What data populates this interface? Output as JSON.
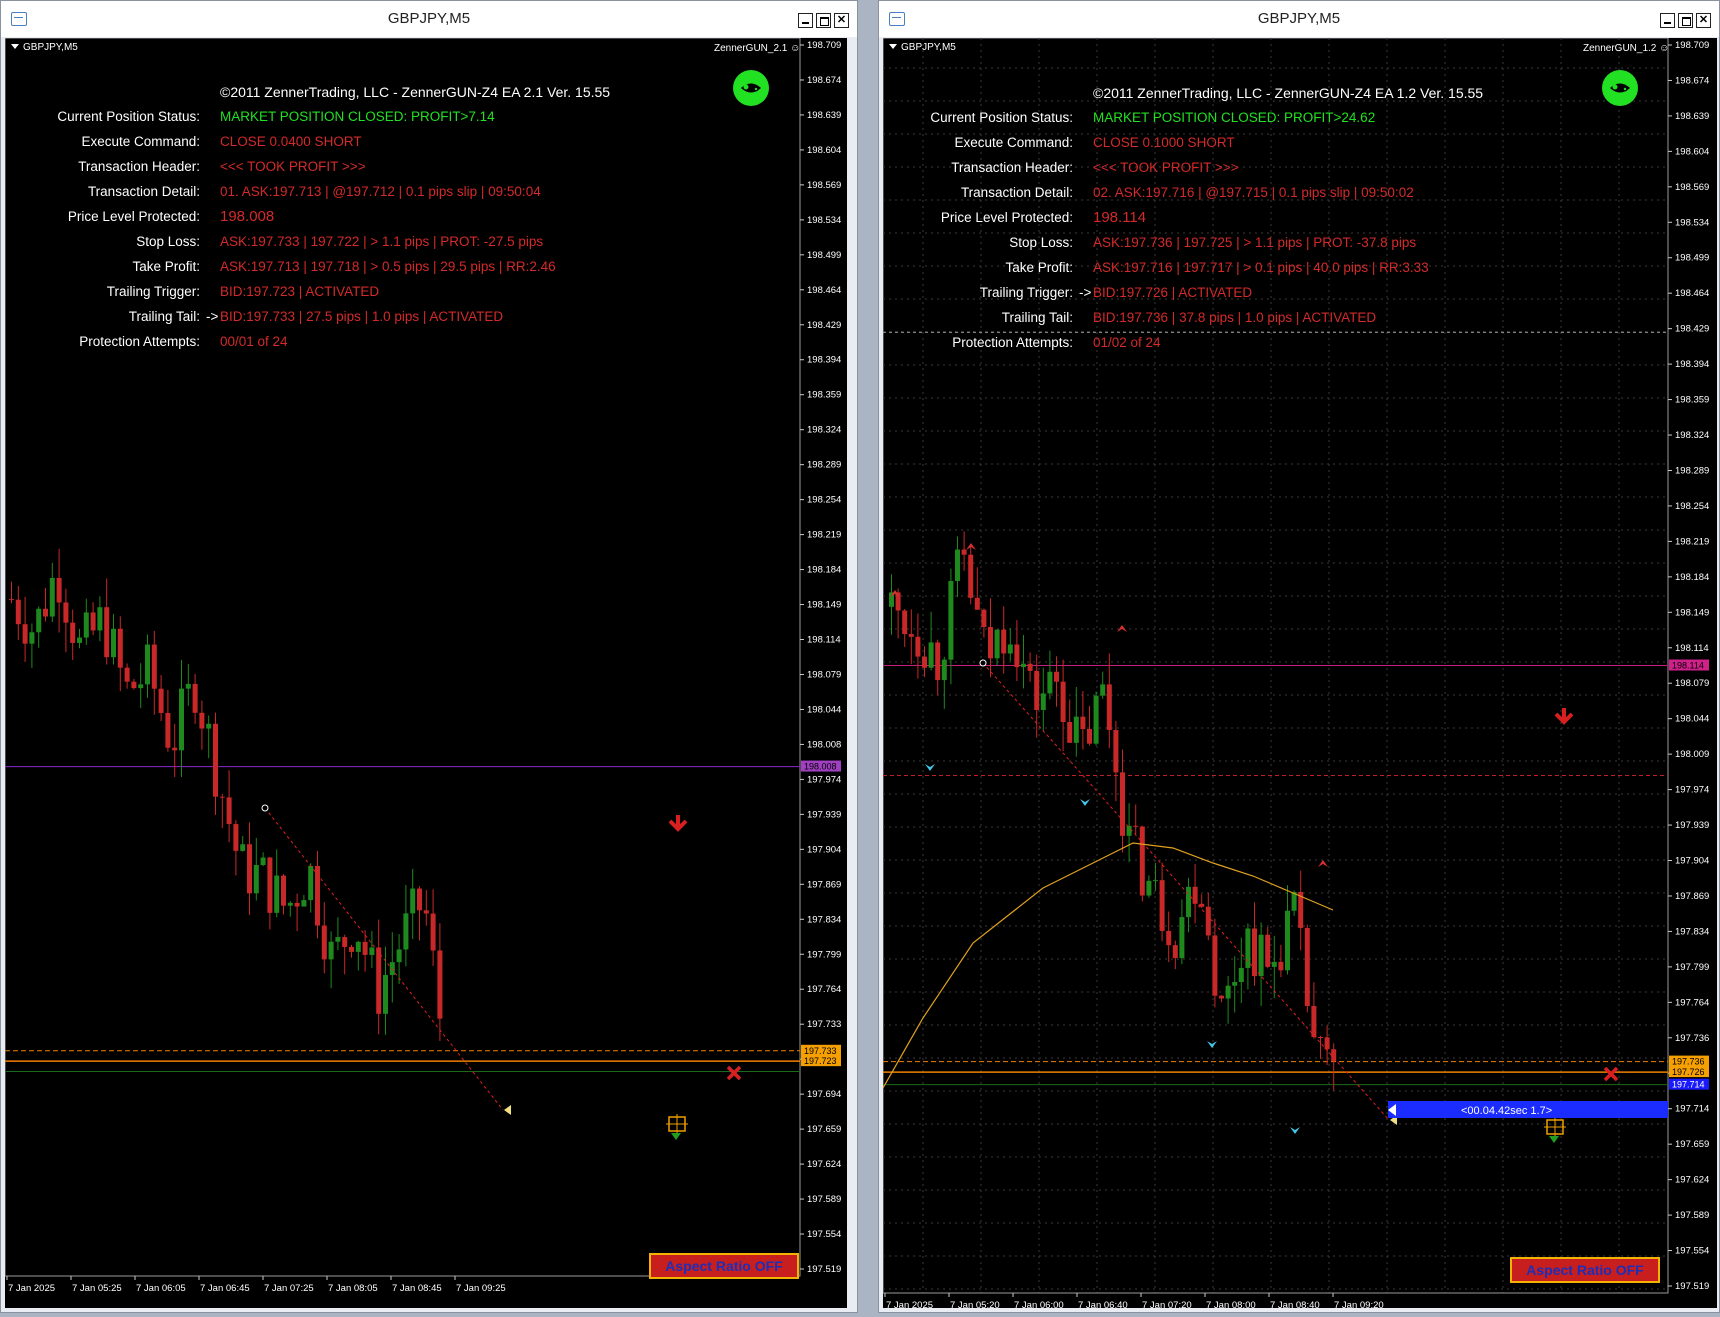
{
  "windows": [
    {
      "id": "left",
      "title": "GBPJPY,M5",
      "symbol_label": "GBPJPY,M5",
      "ea_label": "ZennerGUN_2.1",
      "hud": {
        "copyright": "©2011 ZennerTrading, LLC - ZennerGUN-Z4 EA 2.1 Ver. 15.55",
        "rows": [
          {
            "label": "Current Position Status:",
            "value": "MARKET POSITION CLOSED: PROFIT>7.14",
            "style": "green"
          },
          {
            "label": "Execute Command:",
            "value": "CLOSE 0.0400 SHORT",
            "style": "red"
          },
          {
            "label": "Transaction Header:",
            "value": "<<< TOOK PROFIT >>>",
            "style": "red"
          },
          {
            "label": "Transaction Detail:",
            "value": "01. ASK:197.713 |  @197.712 | 0.1 pips slip | 09:50:04",
            "style": "red"
          },
          {
            "label": "Price Level Protected:",
            "value": "198.008",
            "style": "big"
          },
          {
            "label": "Stop Loss:",
            "value": "ASK:197.733 | 197.722 | > 1.1 pips |  PROT: -27.5 pips",
            "style": "red"
          },
          {
            "label": "Take Profit:",
            "value": "ASK:197.713 | 197.718 | > 0.5 pips | 29.5 pips | RR:2.46",
            "style": "red"
          },
          {
            "label": "Trailing Trigger:",
            "value": "BID:197.723 | ACTIVATED",
            "style": "red"
          },
          {
            "label": "Trailing Tail:",
            "value": "BID:197.733 | 27.5 pips | 1.0 pips | ACTIVATED",
            "style": "red",
            "arrow": "->"
          },
          {
            "label": "Protection Attempts:",
            "value": "00/01 of 24",
            "style": "red"
          }
        ]
      },
      "price_axis": [
        "198.709",
        "198.674",
        "198.639",
        "198.604",
        "198.569",
        "198.534",
        "198.499",
        "198.464",
        "198.429",
        "198.394",
        "198.359",
        "198.324",
        "198.289",
        "198.254",
        "198.219",
        "198.184",
        "198.149",
        "198.114",
        "198.079",
        "198.044",
        "198.008",
        "197.974",
        "197.939",
        "197.904",
        "197.869",
        "197.834",
        "197.799",
        "197.764",
        "197.733",
        "197.723",
        "197.694",
        "197.659",
        "197.624",
        "197.589",
        "197.554",
        "197.519"
      ],
      "price_tags": [
        {
          "text": "198.008",
          "color": "#a040c0",
          "price": 198.008
        },
        {
          "text": "197.733",
          "color": "#f5a000",
          "price": 197.733
        },
        {
          "text": "197.723",
          "color": "#f5a000",
          "price": 197.723
        }
      ],
      "time_axis": [
        "7 Jan 2025",
        "7 Jan 05:25",
        "7 Jan 06:05",
        "7 Jan 06:45",
        "7 Jan 07:25",
        "7 Jan 08:05",
        "7 Jan 08:45",
        "7 Jan 09:25"
      ],
      "aspect_button": "Aspect Ratio OFF"
    },
    {
      "id": "right",
      "title": "GBPJPY,M5",
      "symbol_label": "GBPJPY,M5",
      "ea_label": "ZennerGUN_1.2",
      "hud": {
        "copyright": "©2011 ZennerTrading, LLC - ZennerGUN-Z4 EA 1.2 Ver. 15.55",
        "rows": [
          {
            "label": "Current Position Status:",
            "value": "MARKET POSITION CLOSED: PROFIT>24.62",
            "style": "green"
          },
          {
            "label": "Execute Command:",
            "value": "CLOSE 0.1000 SHORT",
            "style": "red"
          },
          {
            "label": "Transaction Header:",
            "value": "<<< TOOK PROFIT >>>",
            "style": "red"
          },
          {
            "label": "Transaction Detail:",
            "value": "02. ASK:197.716 |  @197.715 | 0.1 pips slip | 09:50:02",
            "style": "red"
          },
          {
            "label": "Price Level Protected:",
            "value": "198.114",
            "style": "big"
          },
          {
            "label": "Stop Loss:",
            "value": "ASK:197.736 | 197.725 | > 1.1 pips |  PROT: -37.8 pips",
            "style": "red"
          },
          {
            "label": "Take Profit:",
            "value": "ASK:197.716 | 197.717 | > 0.1 pips | 40.0 pips | RR:3.33",
            "style": "red"
          },
          {
            "label": "Trailing Trigger:",
            "value": "BID:197.726 | ACTIVATED",
            "style": "red",
            "arrow": "->"
          },
          {
            "label": "Trailing Tail:",
            "value": "BID:197.736 | 37.8 pips | 1.0 pips | ACTIVATED",
            "style": "red"
          },
          {
            "label": "Protection Attempts:",
            "value": "01/02 of 24",
            "style": "red"
          }
        ]
      },
      "price_axis": [
        "198.709",
        "198.674",
        "198.639",
        "198.604",
        "198.569",
        "198.534",
        "198.499",
        "198.464",
        "198.429",
        "198.394",
        "198.359",
        "198.324",
        "198.289",
        "198.254",
        "198.219",
        "198.184",
        "198.149",
        "198.114",
        "198.079",
        "198.044",
        "198.009",
        "197.974",
        "197.939",
        "197.904",
        "197.869",
        "197.834",
        "197.799",
        "197.764",
        "197.736",
        "197.726",
        "197.714",
        "197.659",
        "197.624",
        "197.589",
        "197.554",
        "197.519"
      ],
      "price_tags": [
        {
          "text": "198.114",
          "color": "#d0208a",
          "price": 198.114
        },
        {
          "text": "197.736",
          "color": "#f5a000",
          "price": 197.736
        },
        {
          "text": "197.726",
          "color": "#f5a000",
          "price": 197.726
        },
        {
          "text": "197.714",
          "color": "#1a1aff",
          "price": 197.714
        }
      ],
      "timer_label": "<00.04.42sec 1.7>",
      "time_axis": [
        "7 Jan 2025",
        "7 Jan 05:20",
        "7 Jan 06:00",
        "7 Jan 06:40",
        "7 Jan 07:20",
        "7 Jan 08:00",
        "7 Jan 08:40",
        "7 Jan 09:20"
      ],
      "aspect_button": "Aspect Ratio OFF"
    }
  ],
  "colors": {
    "bull": "#1e8a1e",
    "bear": "#c82828",
    "hud_green": "#22e022",
    "hud_red": "#d42a2a",
    "ma": "#e0a020",
    "stop_line": "#f08000"
  }
}
